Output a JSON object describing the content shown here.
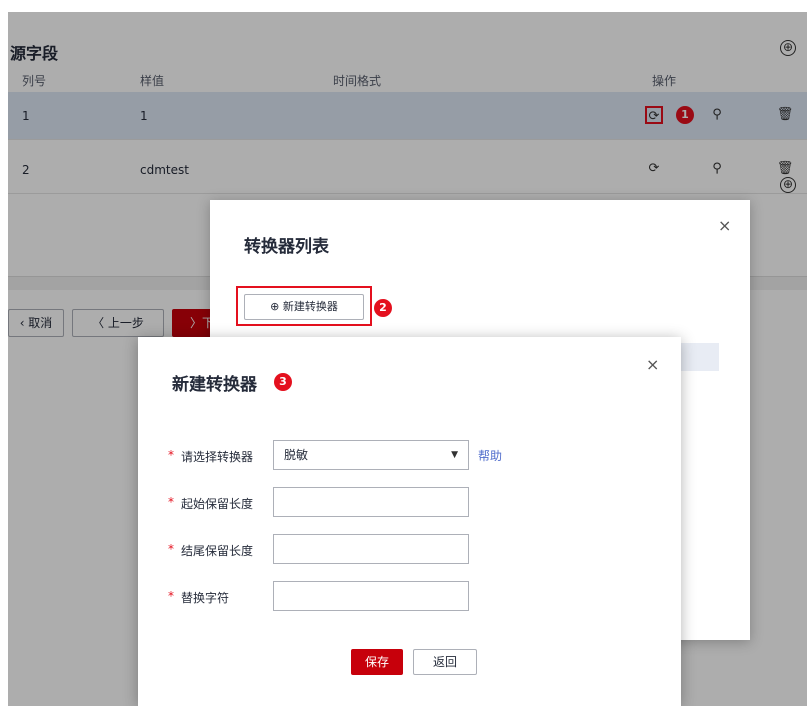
{
  "bg": {
    "section_title": "源字段",
    "add_icon": "⊕",
    "columns": [
      "列号",
      "样值",
      "时间格式",
      "操作"
    ],
    "rows": [
      {
        "col_no": "1",
        "sample": "1",
        "time_format": ""
      },
      {
        "col_no": "2",
        "sample": "cdmtest",
        "time_format": ""
      }
    ],
    "icons": {
      "convert": "⟳",
      "search": "⚲",
      "delete": "🗑"
    },
    "footer": {
      "cancel": "‹ 取消",
      "prev": "〈 上一步",
      "next": "〉下"
    }
  },
  "callouts": {
    "one": "1",
    "two": "2",
    "three": "3"
  },
  "dialog_list": {
    "title": "转换器列表",
    "close": "×",
    "new_button": "⊕ 新建转换器"
  },
  "dialog_new": {
    "title": "新建转换器",
    "close": "×",
    "fields": {
      "converter": {
        "label": "请选择转换器",
        "value": "脱敏"
      },
      "start_len": {
        "label": "起始保留长度",
        "value": ""
      },
      "end_len": {
        "label": "结尾保留长度",
        "value": ""
      },
      "replace_char": {
        "label": "替换字符",
        "value": ""
      }
    },
    "required_mark": "*",
    "help": "帮助",
    "caret": "▼",
    "save": "保存",
    "back": "返回"
  },
  "colors": {
    "accent": "#c7000b",
    "callout": "#e4101e",
    "link": "#526ecc"
  }
}
